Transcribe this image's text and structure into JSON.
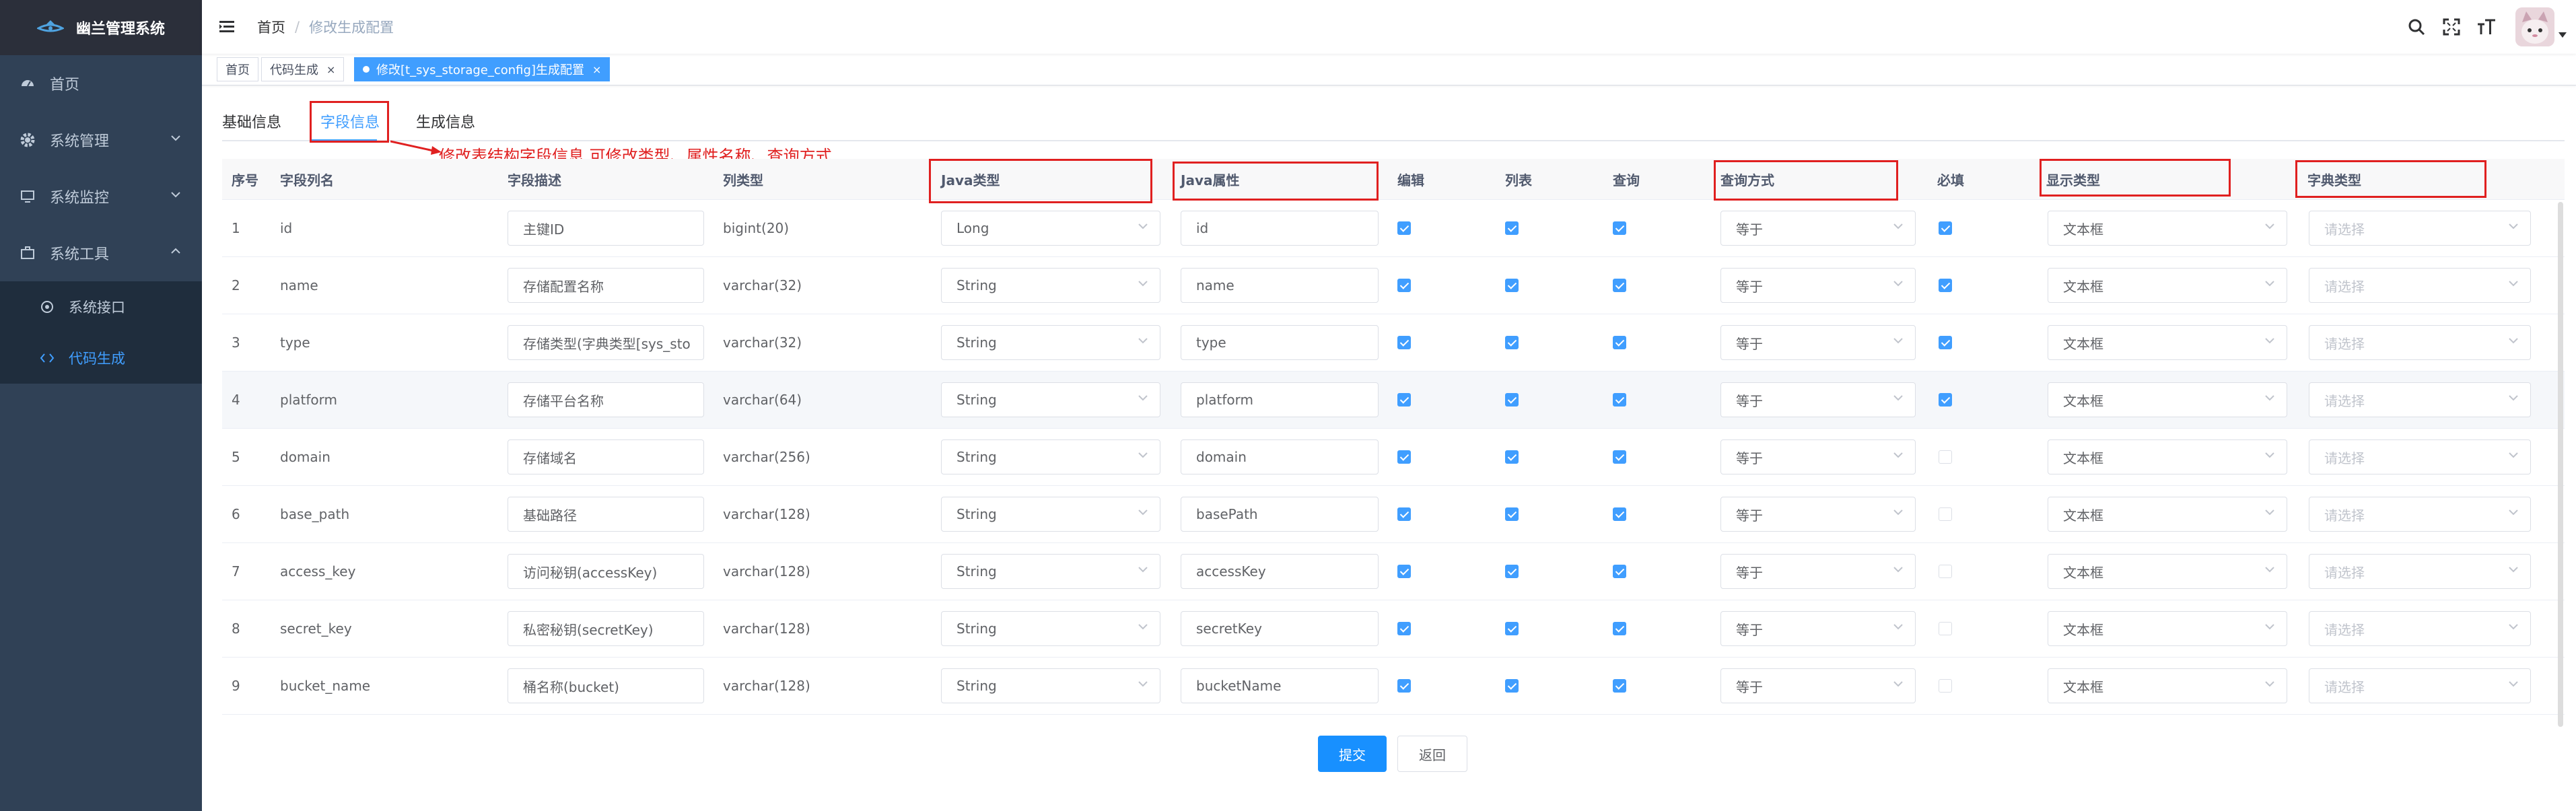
{
  "app": {
    "title": "幽兰管理系统"
  },
  "sidebar": {
    "items": [
      {
        "label": "首页",
        "icon": "dashboard-icon"
      },
      {
        "label": "系统管理",
        "icon": "gear-icon"
      },
      {
        "label": "系统监控",
        "icon": "monitor-icon"
      },
      {
        "label": "系统工具",
        "icon": "toolbox-icon"
      }
    ],
    "subitems": [
      {
        "label": "系统接口",
        "icon": "interface-icon"
      },
      {
        "label": "代码生成",
        "icon": "code-icon"
      }
    ]
  },
  "breadcrumb": {
    "home": "首页",
    "sep": "/",
    "current": "修改生成配置"
  },
  "tags": [
    {
      "label": "首页"
    },
    {
      "label": "代码生成",
      "close": "×"
    },
    {
      "label": "修改[t_sys_storage_config]生成配置",
      "close": "×"
    }
  ],
  "tabs": [
    "基础信息",
    "字段信息",
    "生成信息"
  ],
  "annotation": "修改表结构字段信息,可修改类型、属性名称、查询方式",
  "table": {
    "headers": [
      "序号",
      "字段列名",
      "字段描述",
      "列类型",
      "Java类型",
      "Java属性",
      "编辑",
      "列表",
      "查询",
      "查询方式",
      "必填",
      "显示类型",
      "字典类型"
    ],
    "dict_placeholder": "请选择",
    "rows": [
      {
        "no": "1",
        "column": "id",
        "desc": "主键ID",
        "type": "bigint(20)",
        "java_type": "Long",
        "java_field": "id",
        "edit": true,
        "list": true,
        "query": true,
        "query_type": "等于",
        "required": true,
        "html_type": "文本框"
      },
      {
        "no": "2",
        "column": "name",
        "desc": "存储配置名称",
        "type": "varchar(32)",
        "java_type": "String",
        "java_field": "name",
        "edit": true,
        "list": true,
        "query": true,
        "query_type": "等于",
        "required": true,
        "html_type": "文本框"
      },
      {
        "no": "3",
        "column": "type",
        "desc": "存储类型(字典类型[sys_sto",
        "type": "varchar(32)",
        "java_type": "String",
        "java_field": "type",
        "edit": true,
        "list": true,
        "query": true,
        "query_type": "等于",
        "required": true,
        "html_type": "文本框"
      },
      {
        "no": "4",
        "column": "platform",
        "desc": "存储平台名称",
        "type": "varchar(64)",
        "java_type": "String",
        "java_field": "platform",
        "edit": true,
        "list": true,
        "query": true,
        "query_type": "等于",
        "required": true,
        "html_type": "文本框"
      },
      {
        "no": "5",
        "column": "domain",
        "desc": "存储域名",
        "type": "varchar(256)",
        "java_type": "String",
        "java_field": "domain",
        "edit": true,
        "list": true,
        "query": true,
        "query_type": "等于",
        "required": false,
        "html_type": "文本框"
      },
      {
        "no": "6",
        "column": "base_path",
        "desc": "基础路径",
        "type": "varchar(128)",
        "java_type": "String",
        "java_field": "basePath",
        "edit": true,
        "list": true,
        "query": true,
        "query_type": "等于",
        "required": false,
        "html_type": "文本框"
      },
      {
        "no": "7",
        "column": "access_key",
        "desc": "访问秘钥(accessKey)",
        "type": "varchar(128)",
        "java_type": "String",
        "java_field": "accessKey",
        "edit": true,
        "list": true,
        "query": true,
        "query_type": "等于",
        "required": false,
        "html_type": "文本框"
      },
      {
        "no": "8",
        "column": "secret_key",
        "desc": "私密秘钥(secretKey)",
        "type": "varchar(128)",
        "java_type": "String",
        "java_field": "secretKey",
        "edit": true,
        "list": true,
        "query": true,
        "query_type": "等于",
        "required": false,
        "html_type": "文本框"
      },
      {
        "no": "9",
        "column": "bucket_name",
        "desc": "桶名称(bucket)",
        "type": "varchar(128)",
        "java_type": "String",
        "java_field": "bucketName",
        "edit": true,
        "list": true,
        "query": true,
        "query_type": "等于",
        "required": false,
        "html_type": "文本框"
      }
    ]
  },
  "buttons": {
    "submit": "提交",
    "back": "返回"
  },
  "colors": {
    "sidebar_bg": "#304156",
    "accent": "#409eff",
    "annotation": "#e02020"
  }
}
